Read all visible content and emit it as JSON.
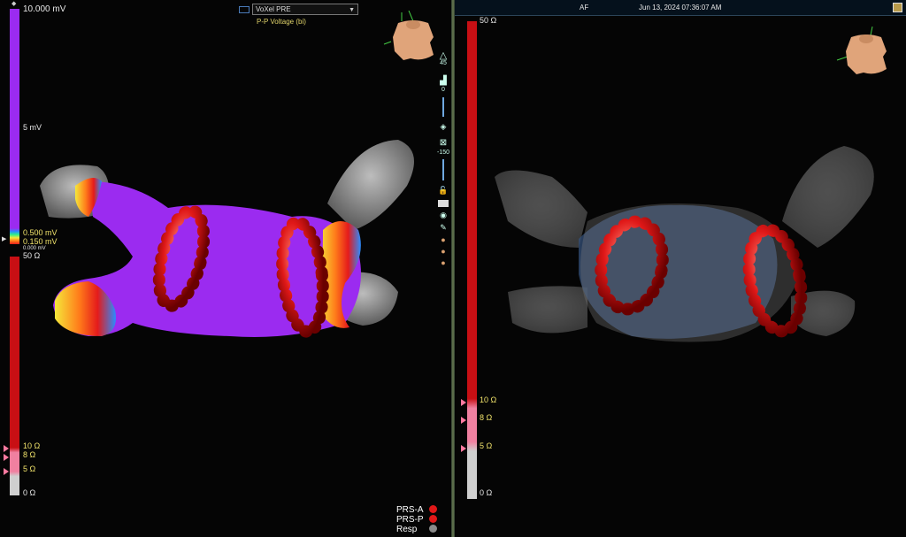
{
  "left": {
    "voltage_scale": {
      "top_label": "10.000 mV",
      "mid_label": "5 mV",
      "upper_threshold": "0.500 mV",
      "lower_threshold": "0.150 mV",
      "bottom_label": "0.000 mV"
    },
    "view_select": {
      "value": "VoXel PRE"
    },
    "map_type": "P-P Voltage (bi)",
    "tools": {
      "brightness": "45",
      "opacity": "0",
      "depth": "-150"
    },
    "impedance_scale": {
      "top_label": "50 Ω",
      "tick_10": "10 Ω",
      "tick_8": "8 Ω",
      "tick_5": "5 Ω",
      "bottom_label": "0 Ω"
    },
    "legend": [
      {
        "label": "PRS-A",
        "color": "#e01818"
      },
      {
        "label": "PRS-P",
        "color": "#e01818"
      },
      {
        "label": "Resp",
        "color": "#8a8a8a"
      }
    ]
  },
  "right": {
    "topbar": {
      "rhythm": "AF",
      "datetime": "Jun 13, 2024 07:36:07 AM"
    },
    "impedance_scale": {
      "top_label": "50 Ω",
      "tick_10": "10 Ω",
      "tick_8": "8 Ω",
      "tick_5": "5 Ω",
      "bottom_label": "0 Ω"
    }
  },
  "colors": {
    "voltage_purple": "#9b2bf0",
    "impedance_red": "#c80f14",
    "impedance_pink": "#f080a0",
    "ablation_red": "#e01818"
  }
}
